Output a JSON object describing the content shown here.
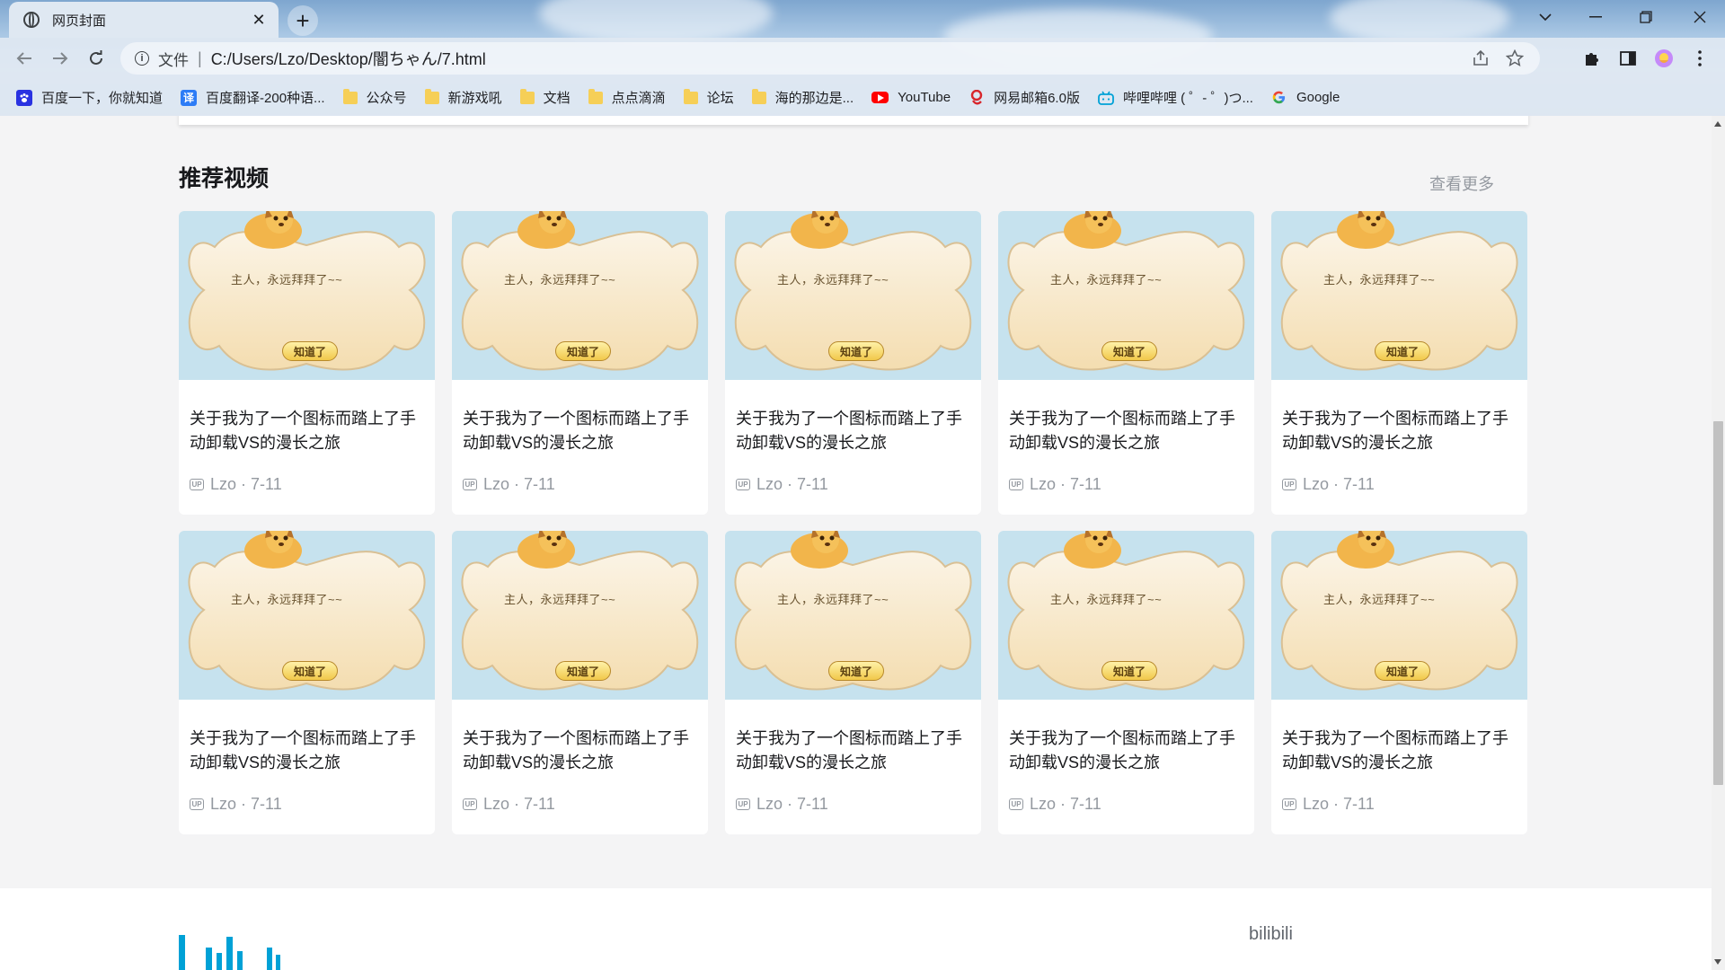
{
  "browser": {
    "tab_title": "网页封面",
    "tab_close": "✕",
    "new_tab": "+",
    "address_scheme": "文件",
    "address_separator": "|",
    "url": "C:/Users/Lzo/Desktop/闇ちゃん/7.html"
  },
  "bookmarks": [
    {
      "label": "百度一下，你就知道",
      "icon": "baidu-icon",
      "color": "#2932e1"
    },
    {
      "label": "百度翻译-200种语...",
      "icon": "baidu-translate-icon",
      "color": "#2d7cf6"
    },
    {
      "label": "公众号",
      "icon": "folder-icon"
    },
    {
      "label": "新游戏吼",
      "icon": "folder-icon"
    },
    {
      "label": "文档",
      "icon": "folder-icon"
    },
    {
      "label": "点点滴滴",
      "icon": "folder-icon"
    },
    {
      "label": "论坛",
      "icon": "folder-icon"
    },
    {
      "label": "海的那边是...",
      "icon": "folder-icon"
    },
    {
      "label": "YouTube",
      "icon": "youtube-icon",
      "color": "#ff0000"
    },
    {
      "label": "网易邮箱6.0版",
      "icon": "netease-mail-icon",
      "color": "#d8262c"
    },
    {
      "label": "哔哩哔哩 ( ゜- ゜)つ...",
      "icon": "bilibili-icon",
      "color": "#00a1d6"
    },
    {
      "label": "Google",
      "icon": "google-icon"
    }
  ],
  "section": {
    "title": "推荐视频",
    "more": "查看更多"
  },
  "thumbnail": {
    "bubble_text": "主人，永远拜拜了~~",
    "button_text": "知道了"
  },
  "videos": [
    {
      "title": "关于我为了一个图标而踏上了手动卸载VS的漫长之旅",
      "badge": "UP",
      "meta": "Lzo · 7-11"
    },
    {
      "title": "关于我为了一个图标而踏上了手动卸载VS的漫长之旅",
      "badge": "UP",
      "meta": "Lzo · 7-11"
    },
    {
      "title": "关于我为了一个图标而踏上了手动卸载VS的漫长之旅",
      "badge": "UP",
      "meta": "Lzo · 7-11"
    },
    {
      "title": "关于我为了一个图标而踏上了手动卸载VS的漫长之旅",
      "badge": "UP",
      "meta": "Lzo · 7-11"
    },
    {
      "title": "关于我为了一个图标而踏上了手动卸载VS的漫长之旅",
      "badge": "UP",
      "meta": "Lzo · 7-11"
    },
    {
      "title": "关于我为了一个图标而踏上了手动卸载VS的漫长之旅",
      "badge": "UP",
      "meta": "Lzo · 7-11"
    },
    {
      "title": "关于我为了一个图标而踏上了手动卸载VS的漫长之旅",
      "badge": "UP",
      "meta": "Lzo · 7-11"
    },
    {
      "title": "关于我为了一个图标而踏上了手动卸载VS的漫长之旅",
      "badge": "UP",
      "meta": "Lzo · 7-11"
    },
    {
      "title": "关于我为了一个图标而踏上了手动卸载VS的漫长之旅",
      "badge": "UP",
      "meta": "Lzo · 7-11"
    },
    {
      "title": "关于我为了一个图标而踏上了手动卸载VS的漫长之旅",
      "badge": "UP",
      "meta": "Lzo · 7-11"
    }
  ],
  "footer": {
    "brand": "bilibili"
  },
  "colors": {
    "accent_blue": "#00a1d6",
    "text_primary": "#18191c",
    "text_secondary": "#9499a0"
  }
}
